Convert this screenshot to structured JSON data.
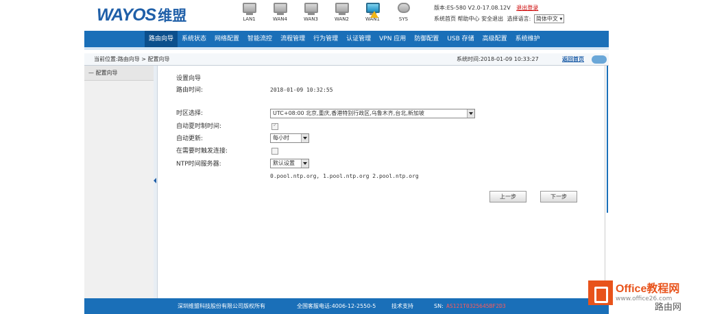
{
  "header": {
    "logo_text": "WAYOS",
    "logo_cn": "维盟",
    "ports": [
      {
        "label": "LAN1",
        "active": false
      },
      {
        "label": "WAN4",
        "active": false
      },
      {
        "label": "WAN3",
        "active": false
      },
      {
        "label": "WAN2",
        "active": false
      },
      {
        "label": "WAN1",
        "active": true
      },
      {
        "label": "SYS",
        "active": false
      }
    ],
    "version_label": "版本:",
    "version_value": "ES-580 V2.0-17.08.12V",
    "logout": "退出登录",
    "links": [
      "系统首页",
      "帮助中心",
      "安全退出"
    ],
    "lang_label": "选择语言:",
    "lang_value": "简体中文"
  },
  "nav": {
    "items": [
      "路由向导",
      "系统状态",
      "网络配置",
      "智能流控",
      "流程管理",
      "行为管理",
      "认证管理",
      "VPN 应用",
      "防御配置",
      "USB 存储",
      "高级配置",
      "系统维护"
    ],
    "active_index": 0
  },
  "breadcrumb": {
    "path": "当前位置:路由向导 > 配置向导",
    "time": "系统时间:2018-01-09 10:33:27",
    "home": "返回首页"
  },
  "sidebar": {
    "items": [
      "— 配置向导"
    ]
  },
  "form": {
    "title": "设置向导",
    "router_time_label": "路由时间:",
    "router_time_value": "2018-01-09 10:32:55",
    "timezone_label": "时区选择:",
    "timezone_value": "UTC+08:00  北京,重庆,香港特别行政区,乌鲁木齐,台北,新加坡",
    "auto_dst_label": "自动夏时制时间:",
    "auto_dst_checked": true,
    "auto_update_label": "自动更新:",
    "auto_update_value": "每小时",
    "reconnect_label": "在需要时触发连接:",
    "reconnect_checked": false,
    "ntp_label": "NTP时间服务器:",
    "ntp_value": "默认设置",
    "ntp_servers": "0.pool.ntp.org, 1.pool.ntp.org 2.pool.ntp.org",
    "prev_button": "上一步",
    "next_button": "下一步"
  },
  "footer": {
    "copyright": "深圳维盟科技股份有限公司版权所有",
    "hotline": "全国客服电话:4006-12-2550-5",
    "support": "技术支持",
    "sn_label": "SN:",
    "sn_value": "AS121T0325645BF2D3"
  },
  "watermark": {
    "brand": "Office教程网",
    "url": "www.office26.com",
    "corner": "路由网"
  },
  "colors": {
    "nav_bg": "#1a6fb8",
    "nav_active": "#0b4f8c",
    "brand": "#1f5fa8",
    "warn": "#f2b616"
  }
}
